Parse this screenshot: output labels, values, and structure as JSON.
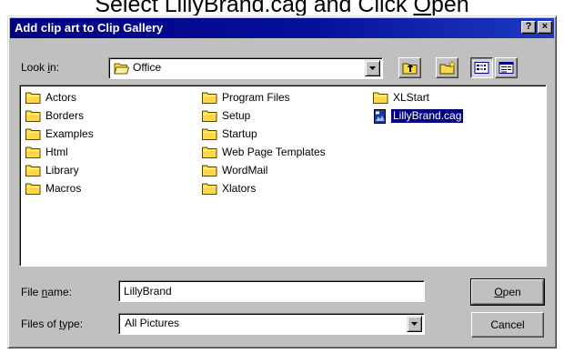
{
  "caption": {
    "before": "Select LillyBrand.cag and Click ",
    "mnemonic": "O",
    "after": "pen"
  },
  "window": {
    "title": "Add clip art to Clip Gallery",
    "help_label": "?",
    "close_label": "×"
  },
  "look_in": {
    "label_before": "Look ",
    "label_mnemonic": "i",
    "label_after": "n:",
    "value": "Office",
    "icon": "folder-open-icon"
  },
  "toolbar": {
    "icons": [
      "up-one-level-icon",
      "create-new-folder-icon",
      "list-view-icon",
      "details-view-icon"
    ],
    "active_view": "list-view"
  },
  "files": {
    "columns": [
      [
        {
          "name": "Actors",
          "type": "folder"
        },
        {
          "name": "Borders",
          "type": "folder"
        },
        {
          "name": "Examples",
          "type": "folder"
        },
        {
          "name": "Html",
          "type": "folder"
        },
        {
          "name": "Library",
          "type": "folder"
        },
        {
          "name": "Macros",
          "type": "folder"
        }
      ],
      [
        {
          "name": "Program Files",
          "type": "folder"
        },
        {
          "name": "Setup",
          "type": "folder"
        },
        {
          "name": "Startup",
          "type": "folder"
        },
        {
          "name": "Web Page Templates",
          "type": "folder"
        },
        {
          "name": "WordMail",
          "type": "folder"
        },
        {
          "name": "Xlators",
          "type": "folder"
        }
      ],
      [
        {
          "name": "XLStart",
          "type": "folder"
        },
        {
          "name": "LillyBrand.cag",
          "type": "file",
          "selected": true
        }
      ]
    ]
  },
  "file_name": {
    "label_before": "File ",
    "label_mnemonic": "n",
    "label_after": "ame:",
    "value": "LillyBrand"
  },
  "file_type": {
    "label_before": "Files of ",
    "label_mnemonic": "t",
    "label_after": "ype:",
    "value": "All Pictures"
  },
  "buttons": {
    "open_mnemonic": "O",
    "open_rest": "pen",
    "cancel": "Cancel"
  },
  "colors": {
    "titlebar": "#000082",
    "face": "#c0c0c0",
    "selection": "#000080",
    "folder": "#ffd84a"
  }
}
